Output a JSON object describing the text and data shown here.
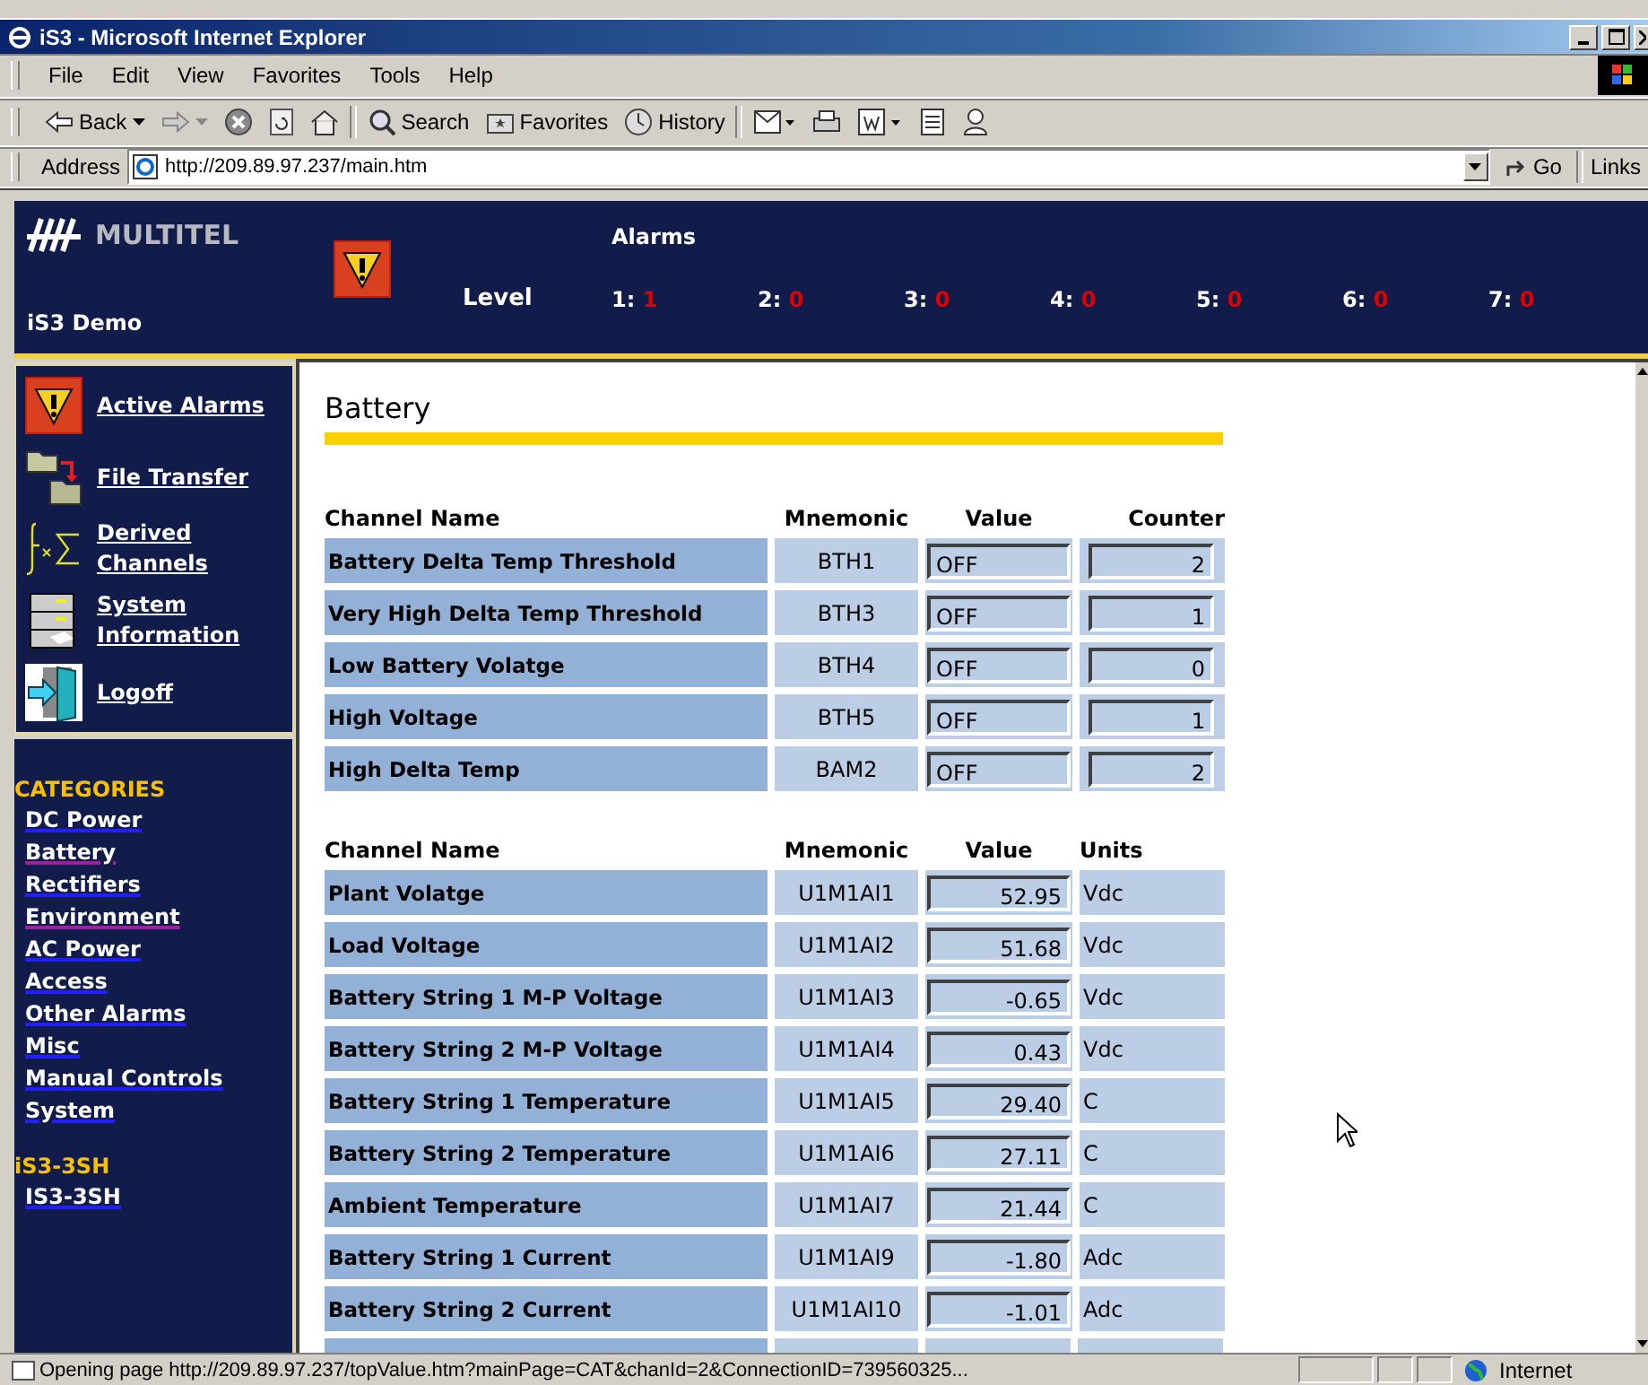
{
  "window": {
    "title": "iS3 - Microsoft Internet Explorer"
  },
  "menu": [
    "File",
    "Edit",
    "View",
    "Favorites",
    "Tools",
    "Help"
  ],
  "toolbar": [
    {
      "kind": "back",
      "label": "Back"
    },
    {
      "kind": "forward"
    },
    {
      "kind": "stop"
    },
    {
      "kind": "refresh"
    },
    {
      "kind": "home"
    },
    {
      "kind": "search",
      "label": "Search"
    },
    {
      "kind": "favorites",
      "label": "Favorites"
    },
    {
      "kind": "history",
      "label": "History"
    },
    {
      "kind": "mail"
    },
    {
      "kind": "print"
    },
    {
      "kind": "edit"
    },
    {
      "kind": "discuss"
    },
    {
      "kind": "messenger"
    }
  ],
  "address": {
    "label": "Address",
    "url": "http://209.89.97.237/main.htm",
    "go": "Go",
    "links": "Links"
  },
  "header": {
    "brand": "MULTITEL",
    "site": "iS3 Demo",
    "alarms_title": "Alarms",
    "level_label": "Level",
    "levels": [
      {
        "label": "1:",
        "count": "1"
      },
      {
        "label": "2:",
        "count": "0"
      },
      {
        "label": "3:",
        "count": "0"
      },
      {
        "label": "4:",
        "count": "0"
      },
      {
        "label": "5:",
        "count": "0"
      },
      {
        "label": "6:",
        "count": "0"
      },
      {
        "label": "7:",
        "count": "0"
      }
    ]
  },
  "sidebar": {
    "nav": [
      {
        "kind": "alarm",
        "label": "Active Alarms"
      },
      {
        "kind": "folders",
        "label": "File Transfer"
      },
      {
        "kind": "formula",
        "label": "Derived Channels"
      },
      {
        "kind": "cabinet",
        "label": "System Information"
      },
      {
        "kind": "logoff",
        "label": "Logoff"
      }
    ],
    "groups": [
      {
        "title": "CATEGORIES",
        "items": [
          {
            "label": "DC Power",
            "visited": false
          },
          {
            "label": "Battery",
            "visited": true
          },
          {
            "label": "Rectifiers",
            "visited": false
          },
          {
            "label": "Environment",
            "visited": true
          },
          {
            "label": "AC Power",
            "visited": false
          },
          {
            "label": "Access",
            "visited": false
          },
          {
            "label": "Other Alarms",
            "visited": false
          },
          {
            "label": "Misc",
            "visited": false
          },
          {
            "label": "Manual Controls",
            "visited": false
          },
          {
            "label": "System",
            "visited": false
          }
        ]
      },
      {
        "title": "iS3-3SH",
        "items": [
          {
            "label": "IS3-3SH",
            "visited": false
          }
        ]
      }
    ]
  },
  "content": {
    "title": "Battery",
    "tables": [
      {
        "kind": "counter",
        "columns": [
          "Channel Name",
          "Mnemonic",
          "Value",
          "Counter"
        ],
        "rows": [
          {
            "name": "Battery Delta Temp Threshold",
            "mnemonic": "BTH1",
            "value": "OFF",
            "extra": "2"
          },
          {
            "name": "Very High Delta Temp Threshold",
            "mnemonic": "BTH3",
            "value": "OFF",
            "extra": "1"
          },
          {
            "name": "Low Battery Volatge",
            "mnemonic": "BTH4",
            "value": "OFF",
            "extra": "0"
          },
          {
            "name": "High Voltage",
            "mnemonic": "BTH5",
            "value": "OFF",
            "extra": "1"
          },
          {
            "name": "High Delta Temp",
            "mnemonic": "BAM2",
            "value": "OFF",
            "extra": "2"
          }
        ]
      },
      {
        "kind": "units",
        "columns": [
          "Channel Name",
          "Mnemonic",
          "Value",
          "Units"
        ],
        "rows": [
          {
            "name": "Plant Volatge",
            "mnemonic": "U1M1AI1",
            "value": "52.95",
            "extra": "Vdc"
          },
          {
            "name": "Load Voltage",
            "mnemonic": "U1M1AI2",
            "value": "51.68",
            "extra": "Vdc"
          },
          {
            "name": "Battery String 1 M-P Voltage",
            "mnemonic": "U1M1AI3",
            "value": "-0.65",
            "extra": "Vdc"
          },
          {
            "name": "Battery String 2 M-P Voltage",
            "mnemonic": "U1M1AI4",
            "value": "0.43",
            "extra": "Vdc"
          },
          {
            "name": "Battery String 1 Temperature",
            "mnemonic": "U1M1AI5",
            "value": "29.40",
            "extra": "C"
          },
          {
            "name": "Battery String 2 Temperature",
            "mnemonic": "U1M1AI6",
            "value": "27.11",
            "extra": "C"
          },
          {
            "name": "Ambient Temperature",
            "mnemonic": "U1M1AI7",
            "value": "21.44",
            "extra": "C"
          },
          {
            "name": "Battery String 1 Current",
            "mnemonic": "U1M1AI9",
            "value": "-1.80",
            "extra": "Adc"
          },
          {
            "name": "Battery String 2 Current",
            "mnemonic": "U1M1AI10",
            "value": "-1.01",
            "extra": "Adc"
          }
        ]
      }
    ]
  },
  "status_bar": {
    "text": "Opening page http://209.89.97.237/topValue.htm?mainPage=CAT&chanId=2&ConnectionID=739560325...",
    "zone": "Internet"
  }
}
